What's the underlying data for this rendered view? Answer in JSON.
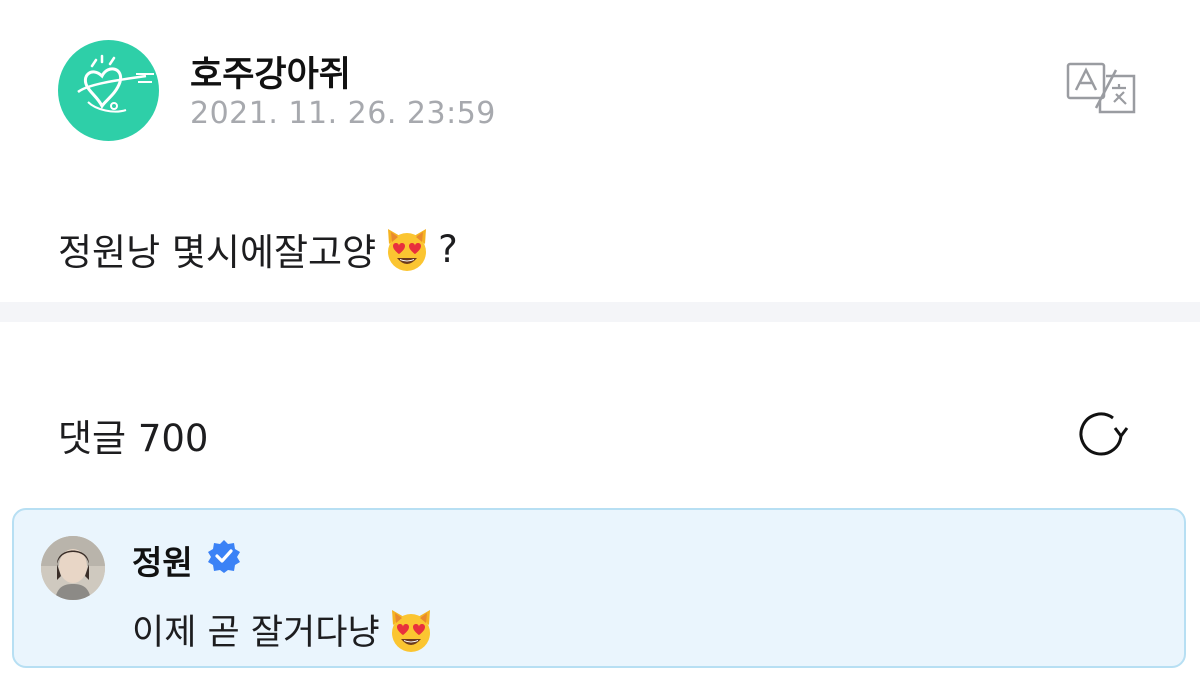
{
  "post": {
    "author": "호주강아쥐",
    "timestamp": "2021. 11. 26. 23:59",
    "body_text": "정원낭 몇시에잘고양",
    "body_emoji": "smiling-cat-with-heart-eyes",
    "body_suffix": "?",
    "translate_icon": "translate-icon"
  },
  "comments": {
    "title": "댓글 700",
    "refresh_icon": "refresh-icon"
  },
  "comment": {
    "name": "정원",
    "verified_icon": "verified-badge-icon",
    "text": "이제 곧 잘거다냥",
    "emoji": "smiling-cat-with-heart-eyes"
  },
  "colors": {
    "logo_bg": "#2ecfa8",
    "timestamp": "#a7a9ae",
    "divider": "#f4f5f8",
    "comment_bg": "#eaf5fd",
    "comment_border": "#b7dff3",
    "verified": "#3b82f6"
  }
}
